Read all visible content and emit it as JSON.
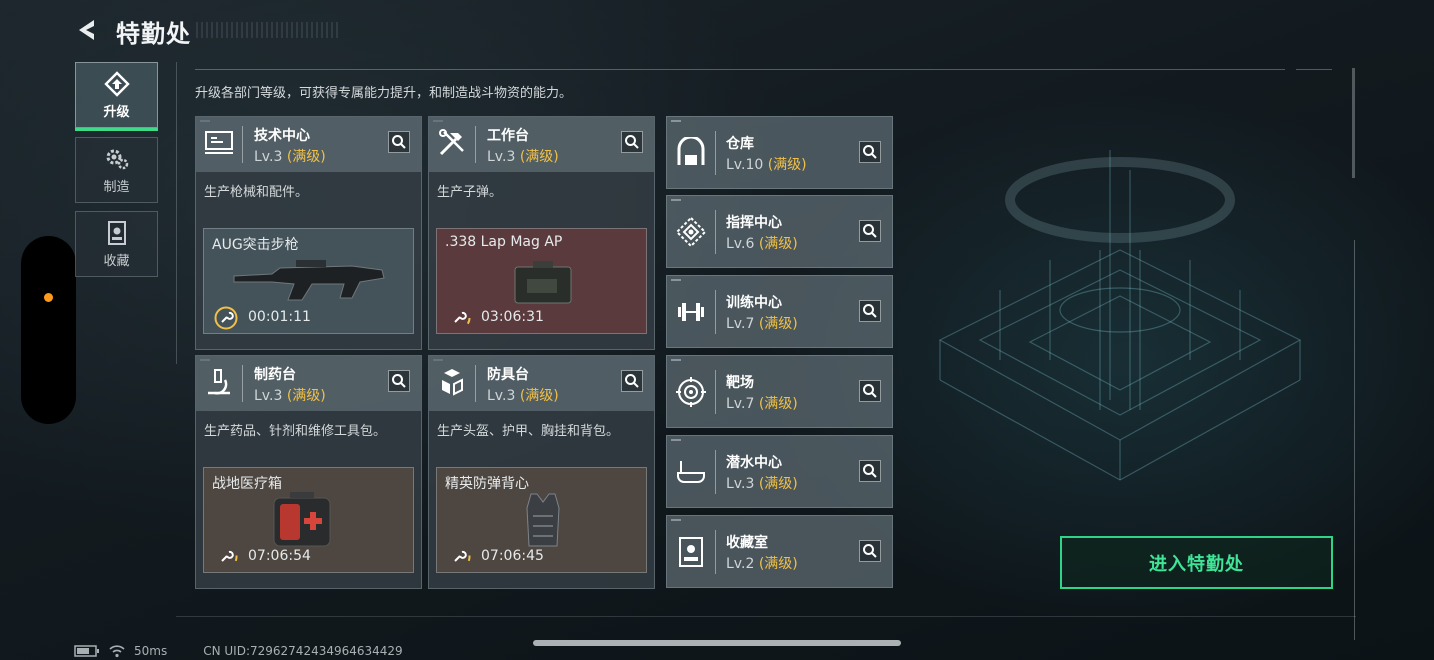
{
  "header": {
    "title": "特勤处",
    "description": "升级各部门等级，可获得专属能力提升，和制造战斗物资的能力。"
  },
  "nav": {
    "items": [
      {
        "label": "升级",
        "icon": "upgrade-icon",
        "active": true
      },
      {
        "label": "制造",
        "icon": "gears-icon",
        "active": false
      },
      {
        "label": "收藏",
        "icon": "collection-icon",
        "active": false
      }
    ]
  },
  "workbenches": [
    {
      "name": "技术中心",
      "level": "Lv.3",
      "status": "(满级)",
      "icon": "monitor-icon",
      "desc": "生产枪械和配件。",
      "craft": {
        "item": "AUG突击步枪",
        "timer": "00:01:11"
      }
    },
    {
      "name": "工作台",
      "level": "Lv.3",
      "status": "(满级)",
      "icon": "tools-icon",
      "desc": "生产子弹。",
      "craft": {
        "item": ".338 Lap Mag AP",
        "timer": "03:06:31"
      }
    },
    {
      "name": "制药台",
      "level": "Lv.3",
      "status": "(满级)",
      "icon": "microscope-icon",
      "desc": "生产药品、针剂和维修工具包。",
      "craft": {
        "item": "战地医疗箱",
        "timer": "07:06:54"
      }
    },
    {
      "name": "防具台",
      "level": "Lv.3",
      "status": "(满级)",
      "icon": "armor-blocks-icon",
      "desc": "生产头盔、护甲、胸挂和背包。",
      "craft": {
        "item": "精英防弹背心",
        "timer": "07:06:45"
      }
    }
  ],
  "rooms": [
    {
      "name": "仓库",
      "level": "Lv.10",
      "status": "(满级)",
      "icon": "warehouse-icon"
    },
    {
      "name": "指挥中心",
      "level": "Lv.6",
      "status": "(满级)",
      "icon": "command-icon"
    },
    {
      "name": "训练中心",
      "level": "Lv.7",
      "status": "(满级)",
      "icon": "dumbbell-icon"
    },
    {
      "name": "靶场",
      "level": "Lv.7",
      "status": "(满级)",
      "icon": "target-icon"
    },
    {
      "name": "潜水中心",
      "level": "Lv.3",
      "status": "(满级)",
      "icon": "diving-mask-icon"
    },
    {
      "name": "收藏室",
      "level": "Lv.2",
      "status": "(满级)",
      "icon": "collection-room-icon"
    }
  ],
  "enter_button": "进入特勤处",
  "status_bar": {
    "ping": "50ms",
    "uid": "CN UID:72962742434964634429"
  },
  "colors": {
    "accent_green": "#3fe497",
    "max_gold": "#f0c048",
    "side_dot": "#ff9b1a"
  }
}
